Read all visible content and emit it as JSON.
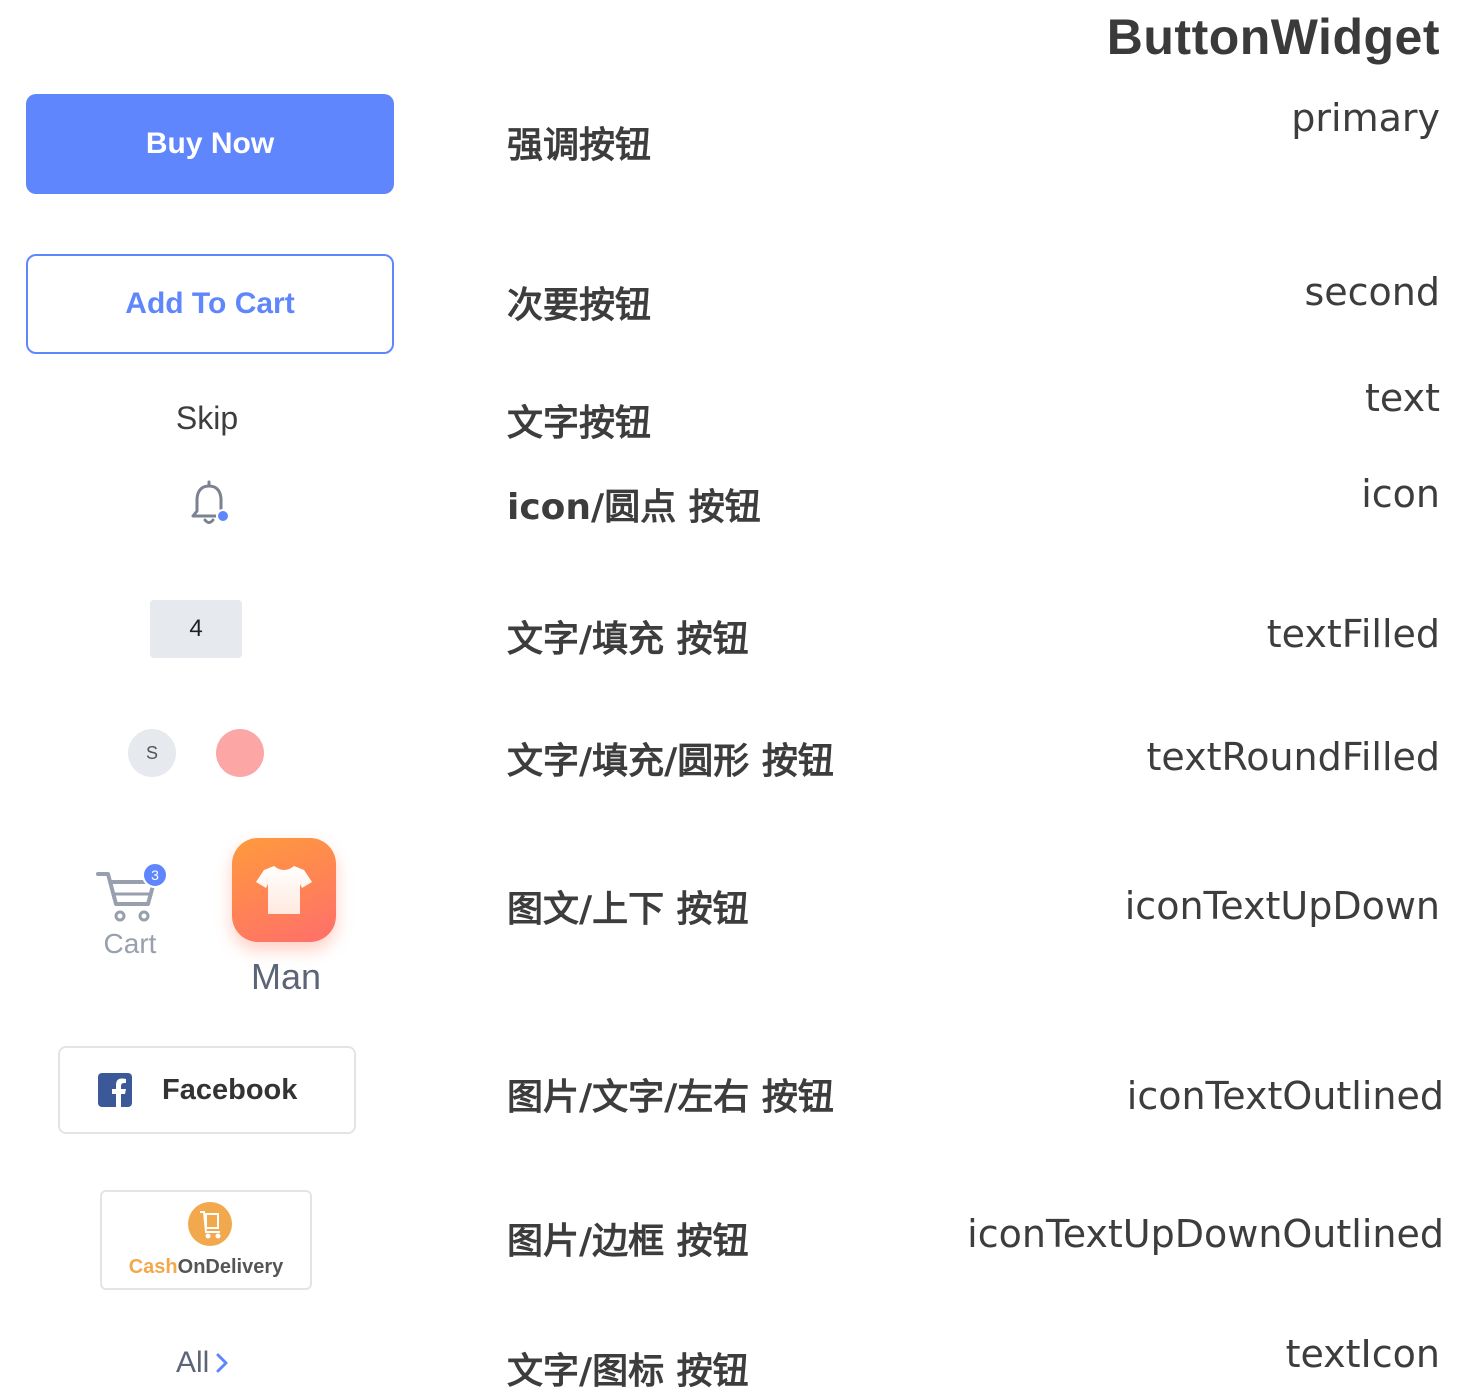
{
  "page": {
    "title": "ButtonWidget"
  },
  "rows": [
    {
      "cn": "强调按钮",
      "en": "primary"
    },
    {
      "cn": "次要按钮",
      "en": "second"
    },
    {
      "cn": "文字按钮",
      "en": "text"
    },
    {
      "cn": "icon/圆点 按钮",
      "en": "icon"
    },
    {
      "cn": "文字/填充 按钮",
      "en": "textFilled"
    },
    {
      "cn": "文字/填充/圆形 按钮",
      "en": "textRoundFilled"
    },
    {
      "cn": "图文/上下 按钮",
      "en": "iconTextUpDown"
    },
    {
      "cn": "图片/文字/左右 按钮",
      "en": "iconTextOutlined"
    },
    {
      "cn": "图片/边框 按钮",
      "en": "iconTextUpDownOutlined"
    },
    {
      "cn": "文字/图标 按钮",
      "en": "textIcon"
    }
  ],
  "buttons": {
    "primary": "Buy Now",
    "second": "Add To Cart",
    "text": "Skip",
    "icon_name": "bell-icon",
    "text_filled": "4",
    "round_filled": "S",
    "cart": {
      "label": "Cart",
      "badge": "3",
      "icon": "cart-icon"
    },
    "man": {
      "label": "Man",
      "icon": "tshirt-icon"
    },
    "facebook": {
      "label": "Facebook",
      "icon": "facebook-icon"
    },
    "cod": {
      "label_a": "Cash",
      "label_b": "OnDelivery",
      "icon": "delivery-icon"
    },
    "all": "All"
  },
  "colors": {
    "accent": "#5f86fc",
    "filled_bg": "#e6e9ee",
    "pink": "#fca6a6",
    "orange_start": "#ff9a3c",
    "orange_end": "#ff6f6b",
    "facebook": "#3b5998",
    "cod": "#f2a94d"
  }
}
